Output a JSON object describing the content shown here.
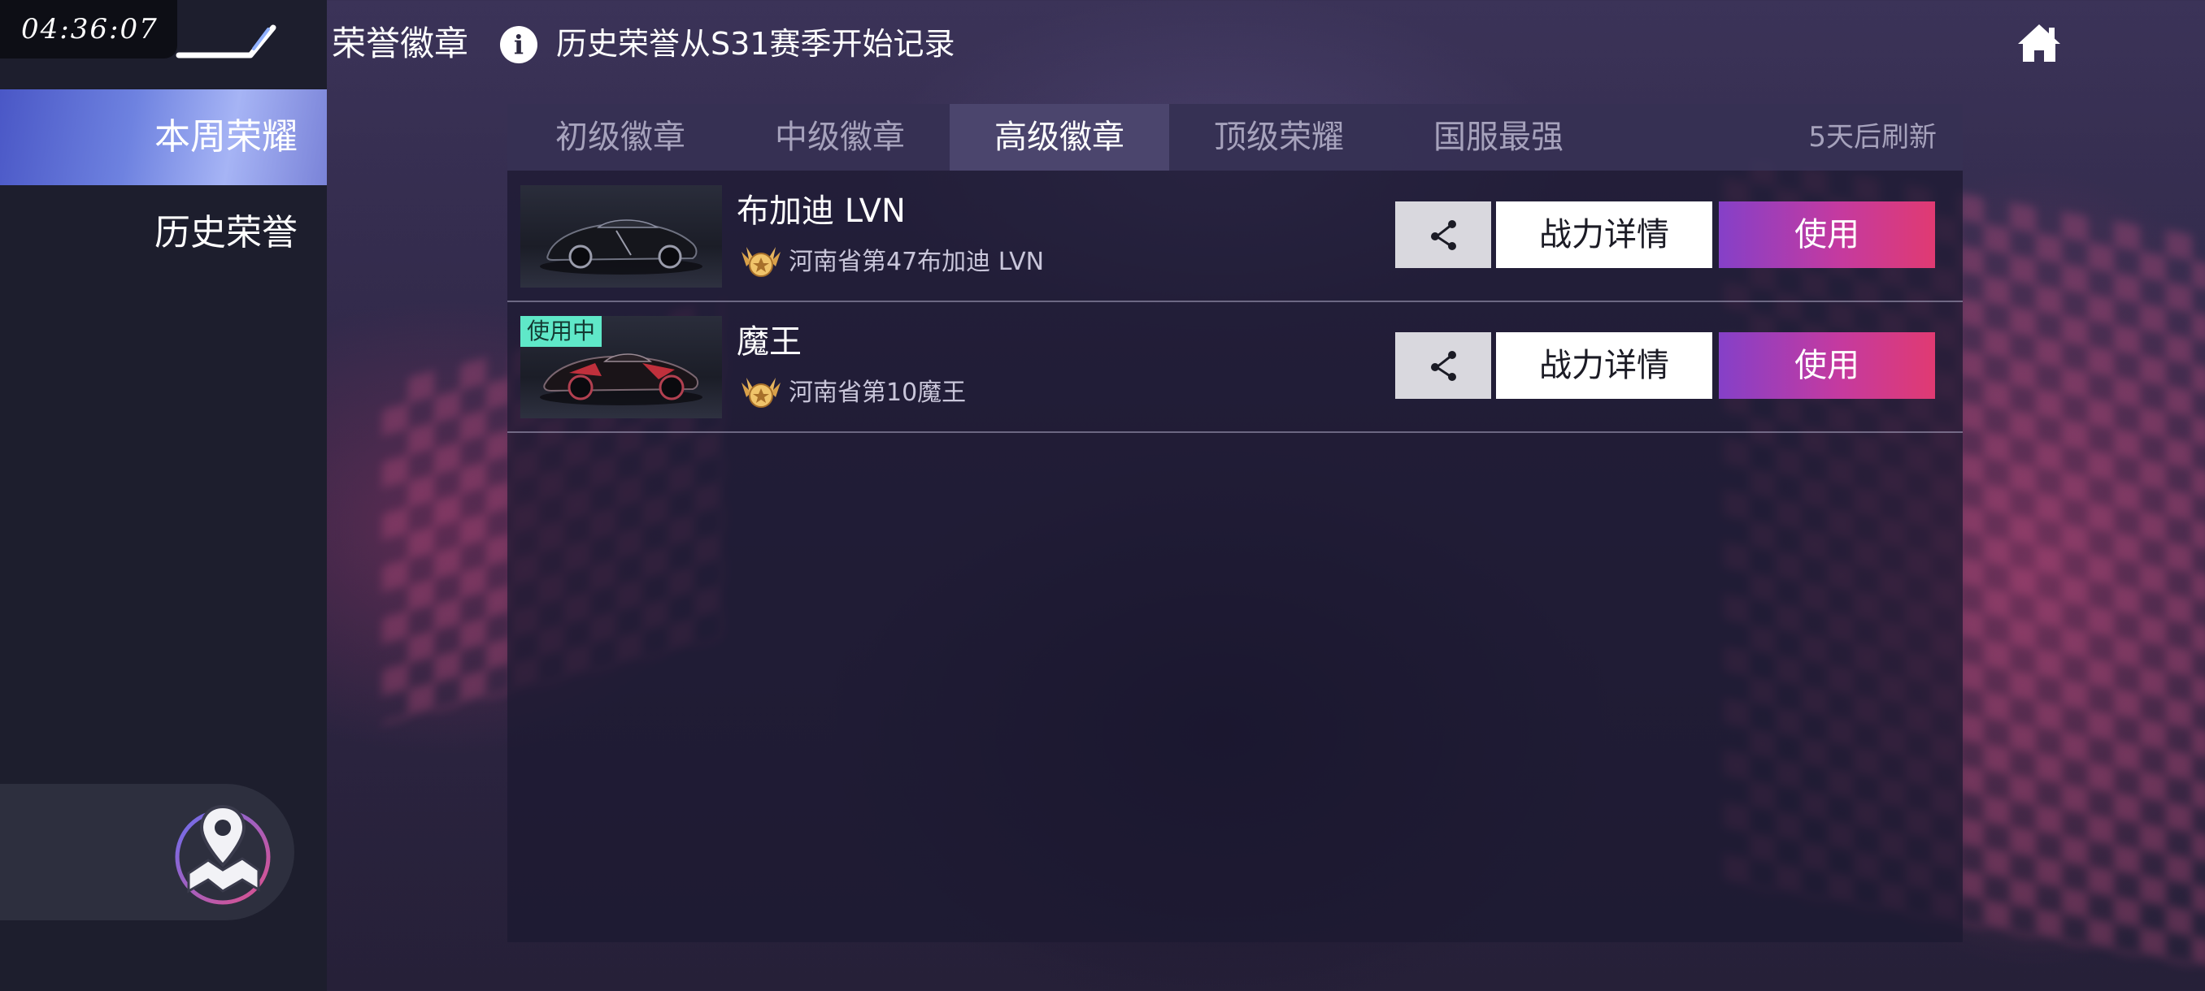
{
  "status": {
    "clock": "04:36:07"
  },
  "header": {
    "title": "荣誉徽章",
    "notice": "历史荣誉从S31赛季开始记录",
    "info_glyph": "i"
  },
  "sidebar": {
    "items": [
      {
        "label": "本周荣耀",
        "active": true
      },
      {
        "label": "历史荣誉",
        "active": false
      }
    ]
  },
  "tabs": [
    {
      "label": "初级徽章",
      "active": false
    },
    {
      "label": "中级徽章",
      "active": false
    },
    {
      "label": "高级徽章",
      "active": true
    },
    {
      "label": "顶级荣耀",
      "active": false
    },
    {
      "label": "国服最强",
      "active": false
    }
  ],
  "refresh_text": "5天后刷新",
  "rows": [
    {
      "car_name": "布加迪 LVN",
      "rank_text": "河南省第47布加迪 LVN",
      "in_use_label": "",
      "detail_label": "战力详情",
      "use_label": "使用"
    },
    {
      "car_name": "魔王",
      "rank_text": "河南省第10魔王",
      "in_use_label": "使用中",
      "detail_label": "战力详情",
      "use_label": "使用"
    }
  ],
  "colors": {
    "sidebar_bg": "#1d1e2d",
    "active_nav": "#6e82e0",
    "use_button_start": "#8540c8",
    "use_button_end": "#e03a72",
    "in_use_tag": "#5fe8c8"
  },
  "icons": [
    "back-arrow-icon",
    "info-icon",
    "home-icon",
    "share-icon",
    "medal-badge-icon",
    "map-location-icon"
  ]
}
